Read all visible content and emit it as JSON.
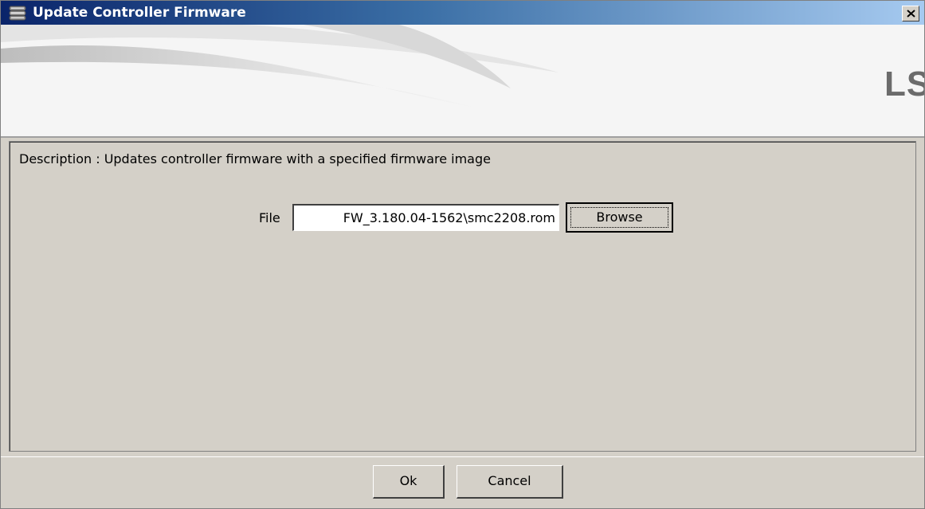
{
  "window": {
    "title": "Update Controller Firmware",
    "icon": "database-icon",
    "close_icon": "close-icon"
  },
  "banner": {
    "logo_text": "LSI",
    "logo_tm": "™",
    "logo_mark_icon": "lsi-starburst-icon",
    "colors": {
      "orange": "#f7941d",
      "teal": "#1aa3b5",
      "green": "#8dc63f",
      "blue": "#3b75c4"
    }
  },
  "content": {
    "description": "Description : Updates controller firmware with a specified firmware image",
    "file_label": "File",
    "file_value": "FW_3.180.04-1562\\smc2208.rom",
    "browse_label": "Browse"
  },
  "footer": {
    "ok_label": "Ok",
    "cancel_label": "Cancel"
  }
}
